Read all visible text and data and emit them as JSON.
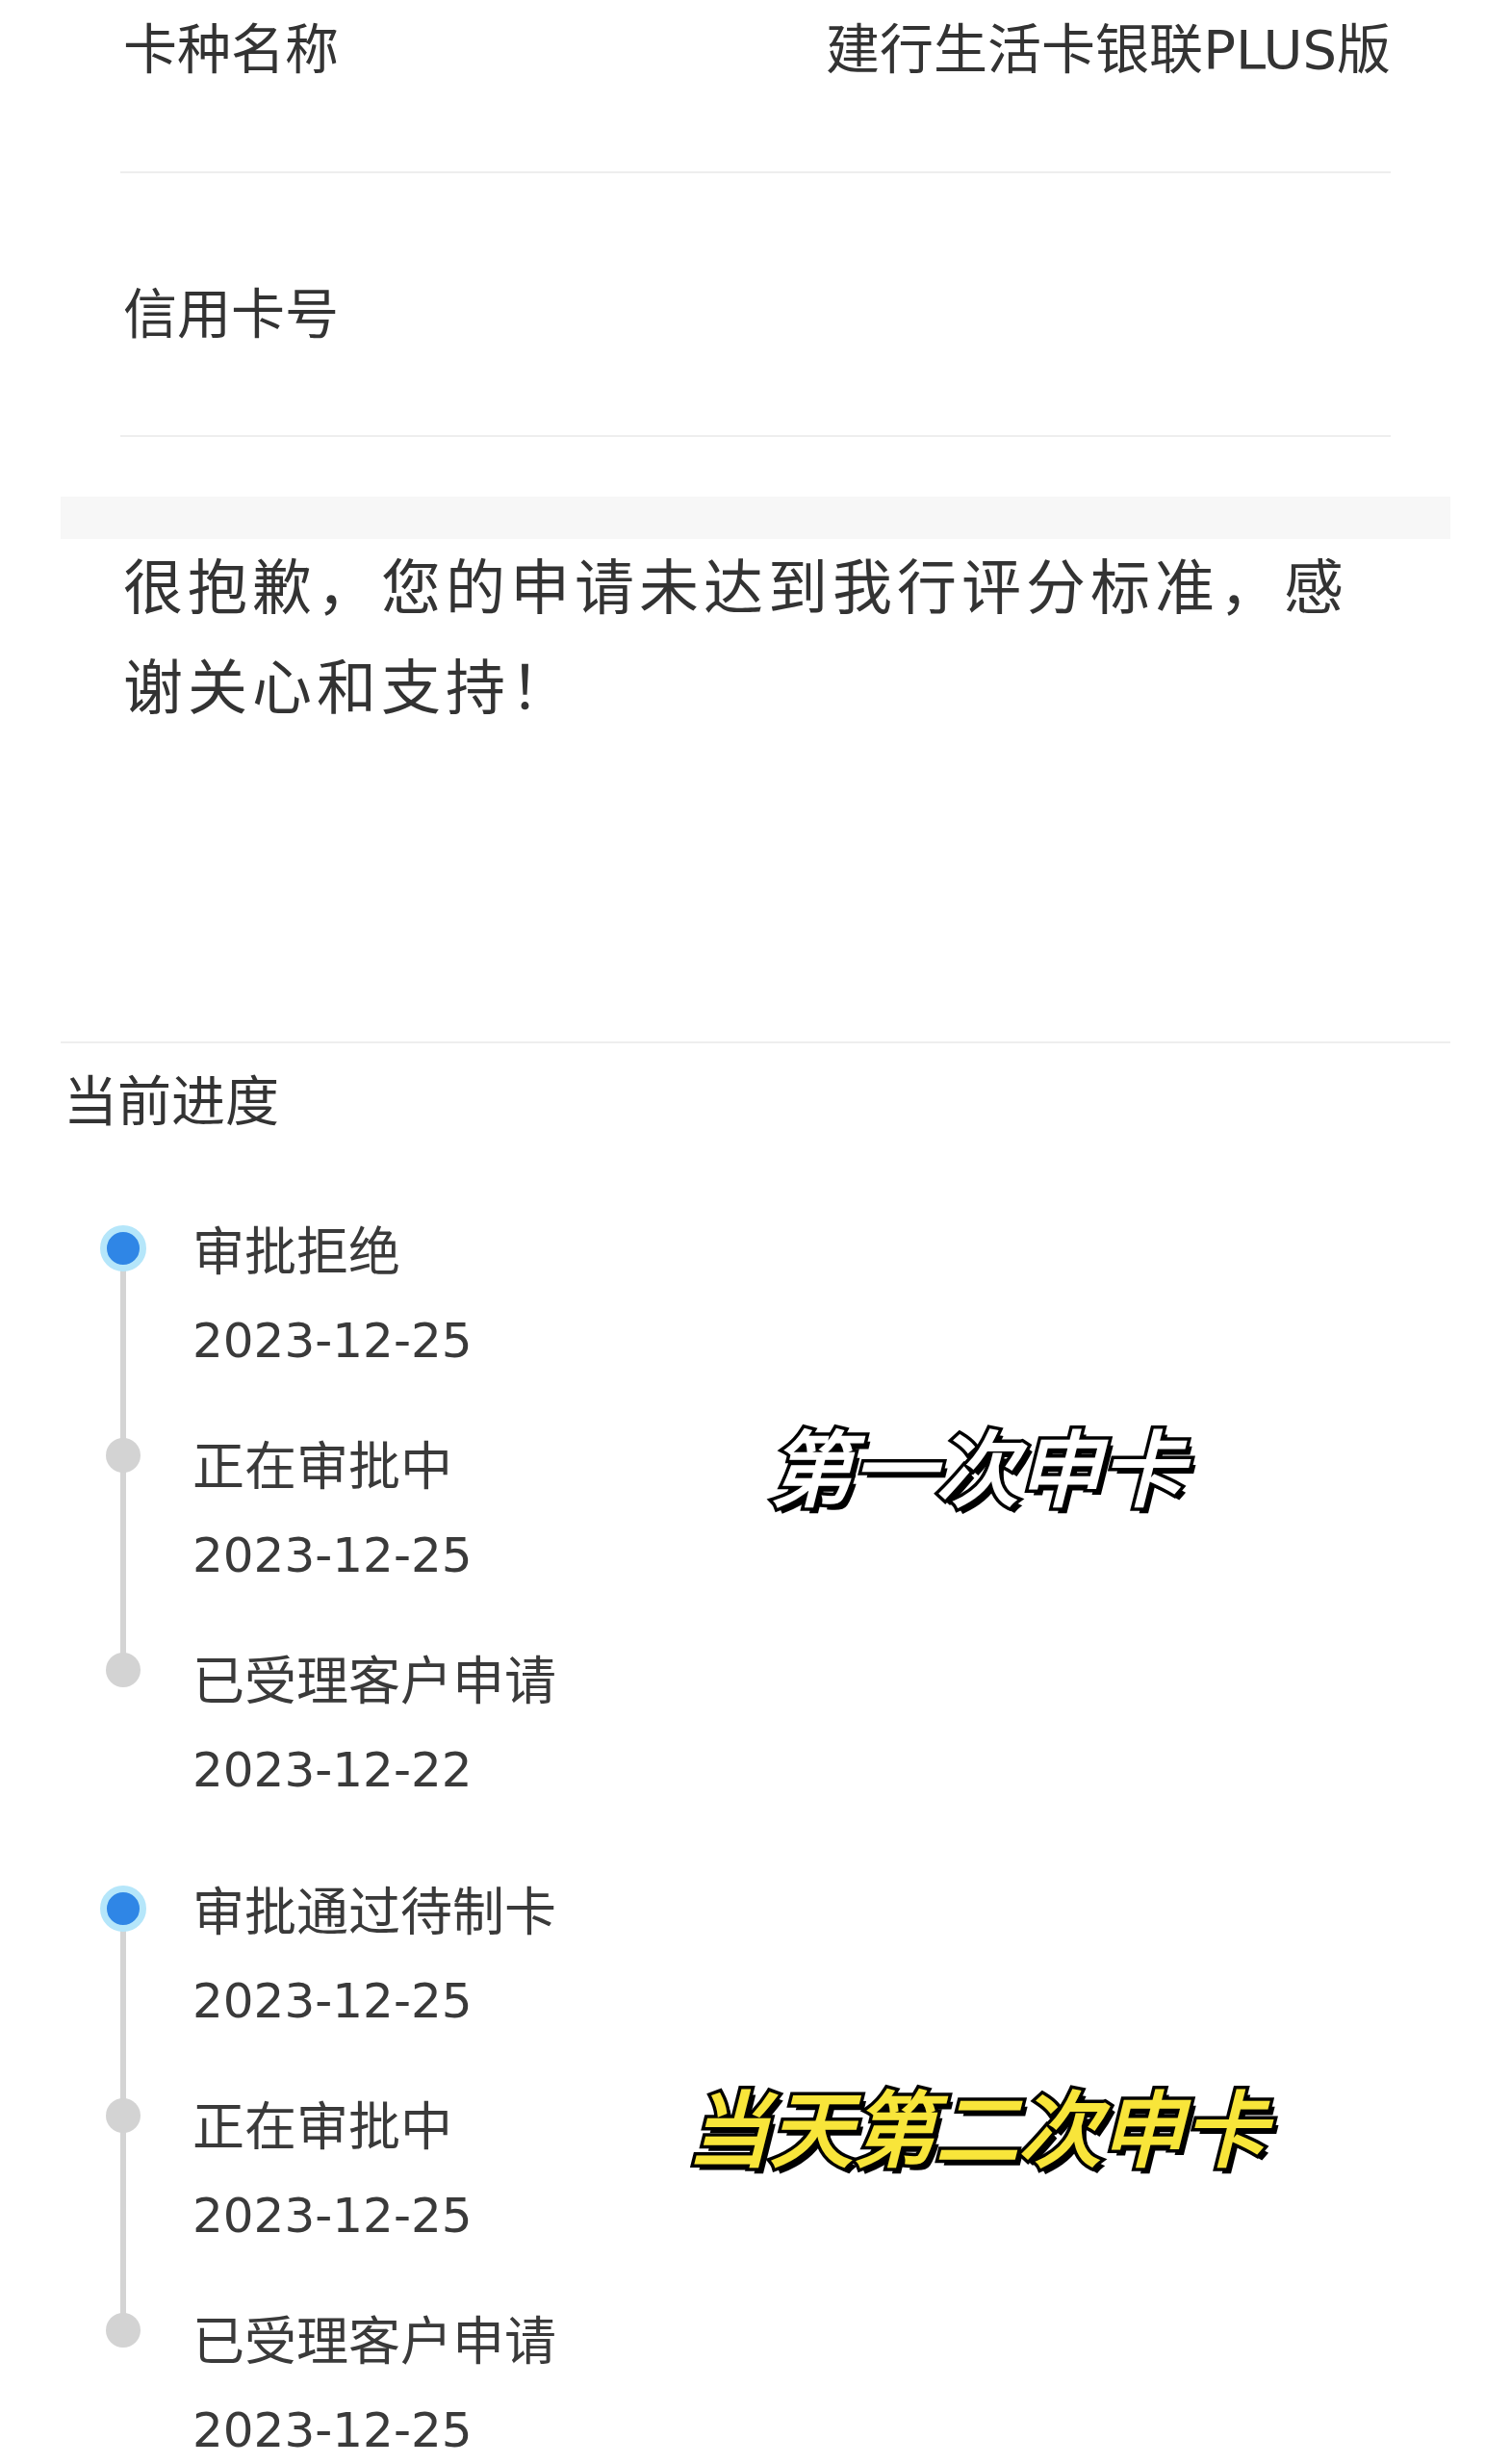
{
  "details": [
    {
      "label": "卡种名称",
      "value": "建行生活卡银联PLUS版"
    },
    {
      "label": "信用卡号"
    }
  ],
  "message": "很抱歉，您的申请未达到我行评分标准，感谢关心和支持！",
  "progress": {
    "title": "当前进度",
    "groups": [
      {
        "steps": [
          {
            "status": "审批拒绝",
            "date": "2023-12-25",
            "active": true
          },
          {
            "status": "正在审批中",
            "date": "2023-12-25",
            "active": false
          },
          {
            "status": "已受理客户申请",
            "date": "2023-12-22",
            "active": false
          }
        ],
        "caption": {
          "text": "第一次申卡",
          "color": "#ffffff"
        }
      },
      {
        "steps": [
          {
            "status": "审批通过待制卡",
            "date": "2023-12-25",
            "active": true
          },
          {
            "status": "正在审批中",
            "date": "2023-12-25",
            "active": false
          },
          {
            "status": "已受理客户申请",
            "date": "2023-12-25",
            "active": false
          }
        ],
        "caption": {
          "text": "当天第二次申卡",
          "color": "#f8e53a"
        }
      }
    ]
  }
}
